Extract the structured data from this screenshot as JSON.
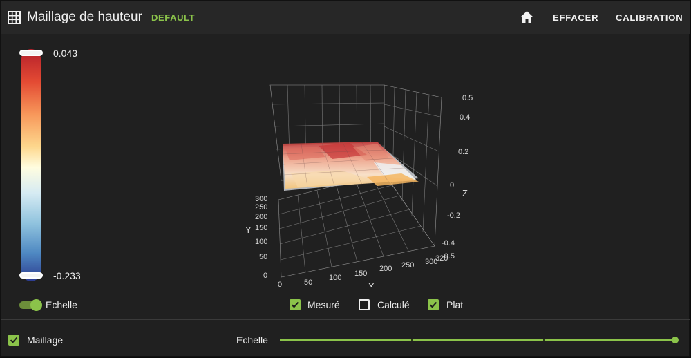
{
  "header": {
    "title": "Maillage de hauteur",
    "profile": "DEFAULT",
    "actions": {
      "clear": "EFFACER",
      "calibrate": "CALIBRATION"
    },
    "accent_color": "#8bc34a"
  },
  "colorbar": {
    "max_label": "0.043",
    "min_label": "-0.233"
  },
  "scale_toggle": {
    "label": "Echelle",
    "on": true
  },
  "legend": {
    "measured": {
      "label": "Mesuré",
      "checked": true
    },
    "computed": {
      "label": "Calculé",
      "checked": false
    },
    "flat": {
      "label": "Plat",
      "checked": true
    }
  },
  "footer": {
    "mesh": {
      "label": "Maillage",
      "checked": true
    },
    "scale_slider": {
      "label": "Echelle",
      "value_fraction": 1.0
    }
  },
  "chart_data": {
    "type": "surface3d",
    "x_axis": {
      "label": "X",
      "ticks": [
        "0",
        "50",
        "100",
        "150",
        "200",
        "250",
        "300",
        "320"
      ]
    },
    "y_axis": {
      "label": "Y",
      "ticks": [
        "0",
        "50",
        "100",
        "150",
        "200",
        "250",
        "300"
      ]
    },
    "z_axis": {
      "label": "Z",
      "ticks": [
        "-0.5",
        "-0.4",
        "-0.2",
        "0",
        "0.2",
        "0.4",
        "0.5"
      ]
    }
  }
}
